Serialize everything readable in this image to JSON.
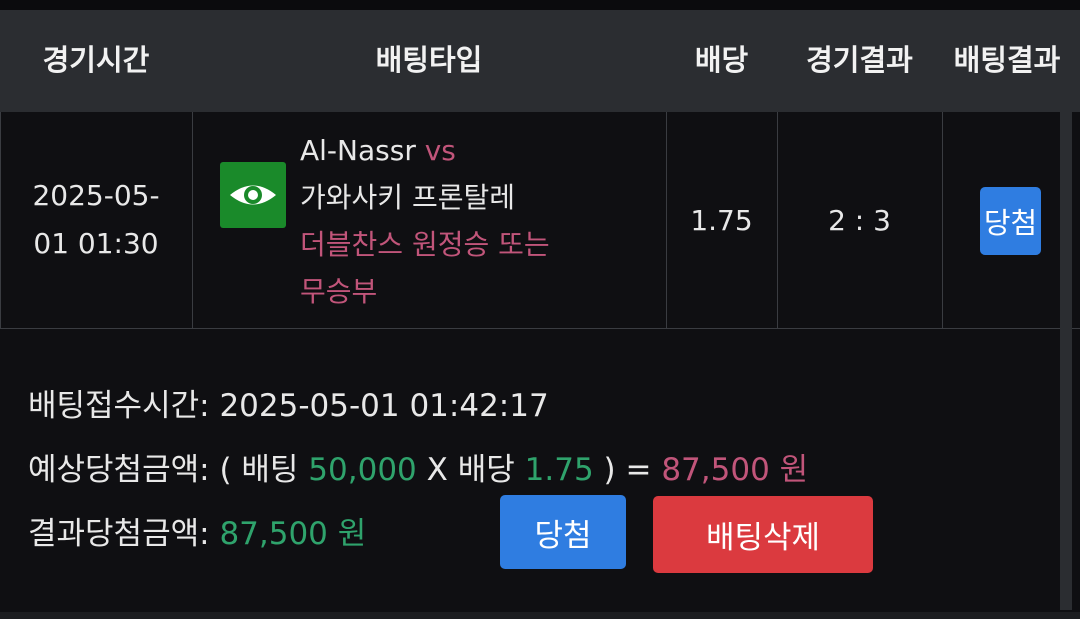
{
  "header": {
    "col_time": "경기시간",
    "col_bettype": "배팅타입",
    "col_odds": "배당",
    "col_game_result": "경기결과",
    "col_bet_result": "배팅결과"
  },
  "bet_row": {
    "time_line1": "2025-05-",
    "time_line2": "01 01:30",
    "icon": "eye-icon",
    "home_team": "Al-Nassr",
    "vs": "vs",
    "away_team": "가와사키 프론탈레",
    "pick_line1": "더블찬스 원정승 또는",
    "pick_line2": "무승부",
    "odds": "1.75",
    "game_result": "2 : 3",
    "bet_result_badge": "당첨"
  },
  "details": {
    "received_label": "배팅접수시간:",
    "received_value": "2025-05-01 01:42:17",
    "expected_label": "예상당첨금액:",
    "expected_open": "( 배팅",
    "expected_stake": "50,000",
    "expected_x": "X 배당",
    "expected_odds": "1.75",
    "expected_close": ") =",
    "expected_amount": "87,500 원",
    "result_label": "결과당첨금액:",
    "result_amount": "87,500 원"
  },
  "buttons": {
    "win": "당첨",
    "delete": "배팅삭제"
  },
  "colors": {
    "header_bg": "#2b2d31",
    "page_bg": "#0f0f12",
    "accent_green": "#2fa36c",
    "accent_pink": "#c1557a",
    "button_blue": "#2f7de1",
    "button_red": "#db3a3f",
    "icon_green": "#1a8a2a"
  }
}
